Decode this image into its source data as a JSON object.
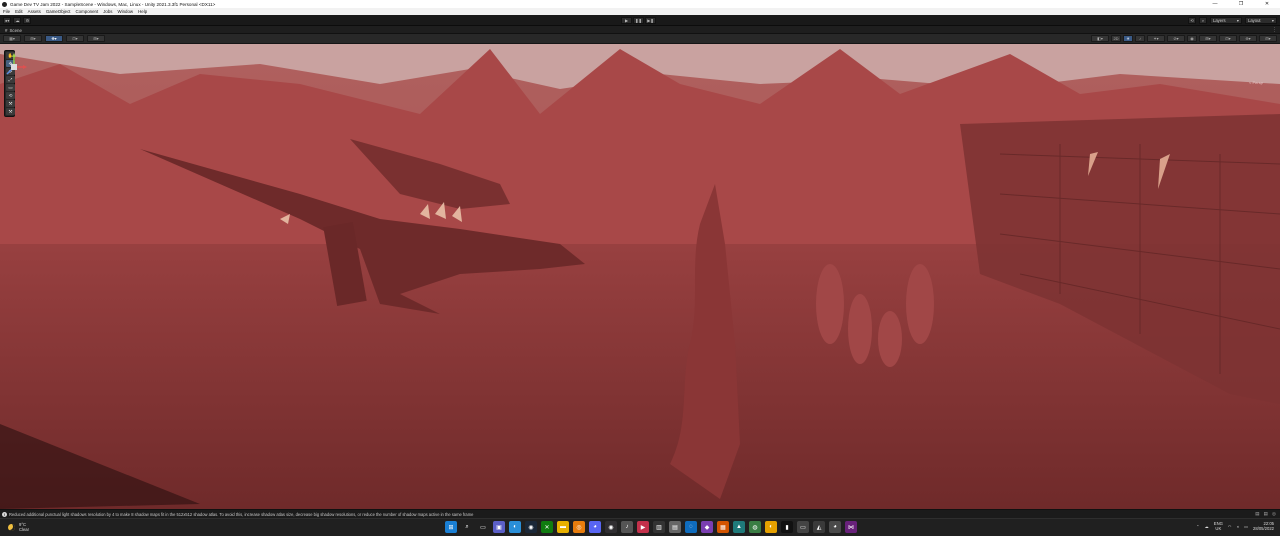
{
  "window": {
    "title": "Game Dev TV Jam 2022 - SampleScene - Windows, Mac, Linux - Unity 2021.3.3f1 Personal <DX11>",
    "controls": {
      "minimize": "—",
      "maximize": "❐",
      "close": "✕"
    }
  },
  "menu": {
    "items": [
      "File",
      "Edit",
      "Assets",
      "GameObject",
      "Component",
      "Jobs",
      "Window",
      "Help"
    ]
  },
  "toolbar": {
    "account": "●▾",
    "cloud": "☁",
    "collab": "⚙",
    "play": "▶",
    "pause": "❚❚",
    "step": "▶❚",
    "history": "⟲",
    "search": "⌕",
    "layers": "Layers",
    "layout": "Layout"
  },
  "scene_tab": {
    "label": "Scene",
    "icon": "#",
    "menu": "⋮"
  },
  "scene_toolbar": {
    "left": [
      "▦▾",
      "⊞▾",
      "✥▾",
      "⊡▾",
      "⊞▾"
    ],
    "right": [
      "◧▾",
      "2D",
      "☀",
      "♪",
      "✦▾",
      "⊘▾",
      "◉",
      "⊞▾",
      "⊡▾",
      "⊕▾",
      "⊟▾"
    ]
  },
  "tools": [
    "✋",
    "✥",
    "⟳",
    "⤢",
    "▭",
    "⟲",
    "⚒",
    "⚒"
  ],
  "gizmo": {
    "persp_label": "< Persp"
  },
  "status": {
    "icon": "!",
    "message": "Reduced additional punctual light shadows resolution by 4 to make 8 shadow maps fit in the 512x512 shadow atlas. To avoid this, increase shadow atlas size, decrease big shadow resolutions, or reduce the number of shadow maps active in the same frame",
    "right_icons": [
      "▤",
      "▤",
      "◎"
    ]
  },
  "taskbar": {
    "weather": {
      "temp": "9°C",
      "condition": "Clear"
    },
    "apps": [
      {
        "name": "windows",
        "glyph": "⊞",
        "color": "#1a7fd4"
      },
      {
        "name": "search",
        "glyph": "⌕",
        "color": "#202020"
      },
      {
        "name": "task-view",
        "glyph": "▭",
        "color": "#202020"
      },
      {
        "name": "chat",
        "glyph": "▣",
        "color": "#5b5fc7"
      },
      {
        "name": "edge",
        "glyph": "◐",
        "color": "#2a8fd8"
      },
      {
        "name": "steam",
        "glyph": "◉",
        "color": "#1b2838"
      },
      {
        "name": "xbox",
        "glyph": "✕",
        "color": "#107c10"
      },
      {
        "name": "explorer",
        "glyph": "▬",
        "color": "#e8b000"
      },
      {
        "name": "blender",
        "glyph": "◎",
        "color": "#e87d0d"
      },
      {
        "name": "discord",
        "glyph": "◕",
        "color": "#5865f2"
      },
      {
        "name": "obs",
        "glyph": "◉",
        "color": "#302e31"
      },
      {
        "name": "mic",
        "glyph": "♪",
        "color": "#555"
      },
      {
        "name": "app-red",
        "glyph": "▶",
        "color": "#c4314b"
      },
      {
        "name": "app-dark",
        "glyph": "▥",
        "color": "#333"
      },
      {
        "name": "app-grey",
        "glyph": "▤",
        "color": "#666"
      },
      {
        "name": "app-circle",
        "glyph": "◌",
        "color": "#0f6cbd"
      },
      {
        "name": "app-purple",
        "glyph": "◆",
        "color": "#7a3eb1"
      },
      {
        "name": "app-orange",
        "glyph": "▦",
        "color": "#d35400"
      },
      {
        "name": "app-teal",
        "glyph": "▲",
        "color": "#1f7a7a"
      },
      {
        "name": "chrome",
        "glyph": "◍",
        "color": "#3a7d44"
      },
      {
        "name": "app-yellow",
        "glyph": "◐",
        "color": "#e6a100"
      },
      {
        "name": "terminal",
        "glyph": "▮",
        "color": "#111"
      },
      {
        "name": "app-white",
        "glyph": "▭",
        "color": "#444"
      },
      {
        "name": "unity",
        "glyph": "◭",
        "color": "#3a3a3a"
      },
      {
        "name": "app-cat",
        "glyph": "◕",
        "color": "#4a4a4a"
      },
      {
        "name": "visual-studio",
        "glyph": "⋈",
        "color": "#68217a"
      }
    ],
    "tray": {
      "chevron": "⌃",
      "lang_line1": "ENG",
      "lang_line2": "UK",
      "time": "22:05",
      "date": "28/05/2022"
    }
  },
  "colors": {
    "scene_fog": "#9a4040",
    "unity_dark": "#191919",
    "accent": "#3a5a86"
  }
}
